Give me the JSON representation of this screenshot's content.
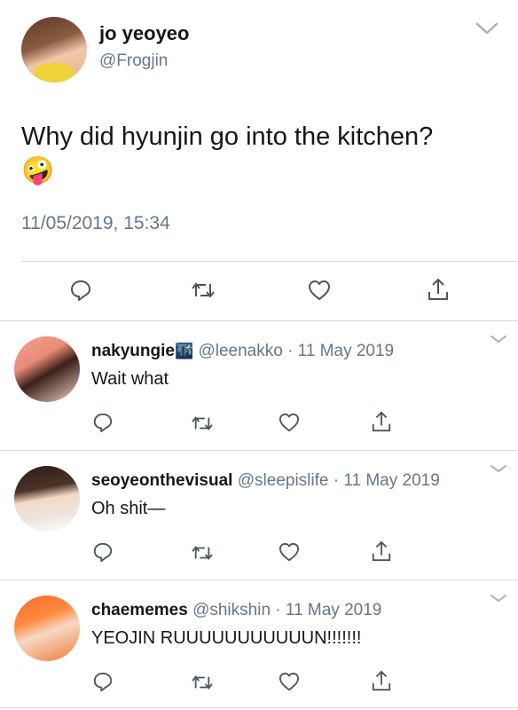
{
  "main_tweet": {
    "display_name": "jo yeoyeo",
    "handle": "@Frogjin",
    "text": "Why did hyunjin go into the kitchen?",
    "emoji": "🤪",
    "timestamp": "11/05/2019, 15:34"
  },
  "actions": {
    "reply": "reply-icon",
    "retweet": "retweet-icon",
    "like": "heart-icon",
    "share": "share-icon"
  },
  "replies": [
    {
      "display_name": "nakyungie",
      "badge": "🌃",
      "handle": "@leenakko",
      "separator": "·",
      "date": "11 May 2019",
      "text": "Wait what"
    },
    {
      "display_name": "seoyeonthevisual",
      "handle": "@sleepislife",
      "separator": "·",
      "date": "11 May 2019",
      "text": "Oh shit—"
    },
    {
      "display_name": "chaememes",
      "handle": "@shikshin",
      "separator": "·",
      "date": "11 May 2019",
      "text": "YEOJIN RUUUUUUUUUUUN!!!!!!!"
    }
  ],
  "colors": {
    "text": "#14171a",
    "muted": "#657786",
    "divider": "#d7dbdf",
    "icon": "#4a5560"
  }
}
